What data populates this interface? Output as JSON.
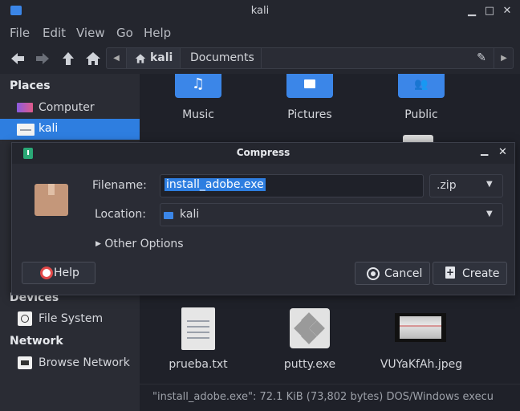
{
  "window": {
    "title": "kali"
  },
  "menu": [
    "File",
    "Edit",
    "View",
    "Go",
    "Help"
  ],
  "path": {
    "crumbs": [
      "kali",
      "Documents"
    ]
  },
  "sidebar": {
    "places_header": "Places",
    "places": [
      {
        "label": "Computer",
        "icon": "computer-icon"
      },
      {
        "label": "kali",
        "icon": "home-folder-icon",
        "selected": true
      }
    ],
    "devices_header": "Devices",
    "devices": [
      {
        "label": "File System",
        "icon": "drive-icon"
      }
    ],
    "network_header": "Network",
    "network": [
      {
        "label": "Browse Network",
        "icon": "network-icon"
      }
    ]
  },
  "files_top": [
    {
      "name": "Music",
      "icon": "music-note-icon"
    },
    {
      "name": "Pictures",
      "icon": "image-icon"
    },
    {
      "name": "Public",
      "icon": "people-icon"
    }
  ],
  "files_bottom": [
    {
      "name": "prueba.txt",
      "icon": "text-file-icon"
    },
    {
      "name": "putty.exe",
      "icon": "exe-file-icon"
    },
    {
      "name": "VUYaKfAh.jpeg",
      "icon": "image-thumbnail-icon"
    }
  ],
  "status": "\"install_adobe.exe\": 72.1 KiB (73,802 bytes) DOS/Windows execu",
  "dialog": {
    "title": "Compress",
    "filename_label": "Filename:",
    "filename_value": "install_adobe.exe",
    "extension": ".zip",
    "location_label": "Location:",
    "location_value": "kali",
    "other_options": "Other Options",
    "help_label": "Help",
    "cancel_label": "Cancel",
    "create_label": "Create"
  },
  "colors": {
    "accent": "#2e7ee0",
    "folder": "#3b86e8",
    "background": "#23252e"
  }
}
